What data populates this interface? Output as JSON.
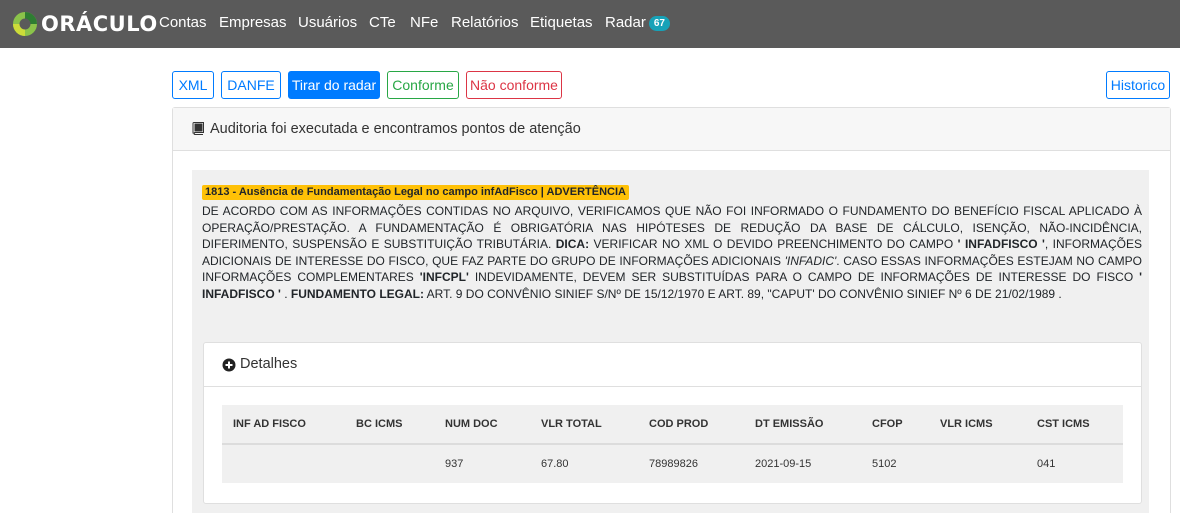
{
  "nav": {
    "brand": "ORÁCULO",
    "items": [
      "Contas",
      "Empresas",
      "Usuários",
      "CTe",
      "NFe",
      "Relatórios",
      "Etiquetas",
      "Radar"
    ],
    "radar_badge": "67"
  },
  "actions": {
    "xml": "XML",
    "danfe": "DANFE",
    "tirar_radar": "Tirar do radar",
    "conforme": "Conforme",
    "nao_conforme": "Não conforme",
    "historico": "Historico"
  },
  "audit": {
    "header": "Auditoria foi executada e encontramos pontos de atenção",
    "issue_title": "1813 - Ausência de Fundamentação Legal no campo infAdFisco | ADVERTÊNCIA",
    "desc": {
      "p1": "De acordo com as informações contidas no arquivo, verificamos que não foi informado o fundamento do benefício fiscal aplicado à operação/prestação. A fundamentação é obrigatória nas hipóteses de redução da base de cálculo, isenção, não-incidência, diferimento, suspensão e substituição tributária.",
      "dica_label": "DICA:",
      "p2": " Verificar no XML o devido preenchimento do campo ",
      "field1": "' infAdFisco '",
      "p3": ", informações adicionais de interesse do fisco, que faz parte do grupo de informações adicionais ",
      "field_italic": "'infAdic'",
      "p4": ". Caso essas informações estejam no campo informações complementares ",
      "field2": "'infCpl'",
      "p5": " indevidamente, devem ser substituídas para o campo de informações de interesse do fisco ",
      "field3": "' infAdFisco '",
      "p6": " .",
      "fundamento_label": "FUNDAMENTO LEGAL:",
      "p7": " ART. 9 DO CONVÊNIO SINIEF S/Nº DE 15/12/1970 E ART. 89, \"CAPUT' DO CONVÊNIO SINIEF Nº 6 DE 21/02/1989 ."
    },
    "details_label": "Detalhes",
    "table": {
      "headers": [
        "INF AD FISCO",
        "BC ICMS",
        "NUM DOC",
        "VLR TOTAL",
        "COD PROD",
        "DT EMISSÃO",
        "CFOP",
        "VLR ICMS",
        "CST ICMS"
      ],
      "row": [
        "",
        "",
        "937",
        "67.80",
        "78989826",
        "2021-09-15",
        "5102",
        "",
        "041"
      ]
    }
  }
}
